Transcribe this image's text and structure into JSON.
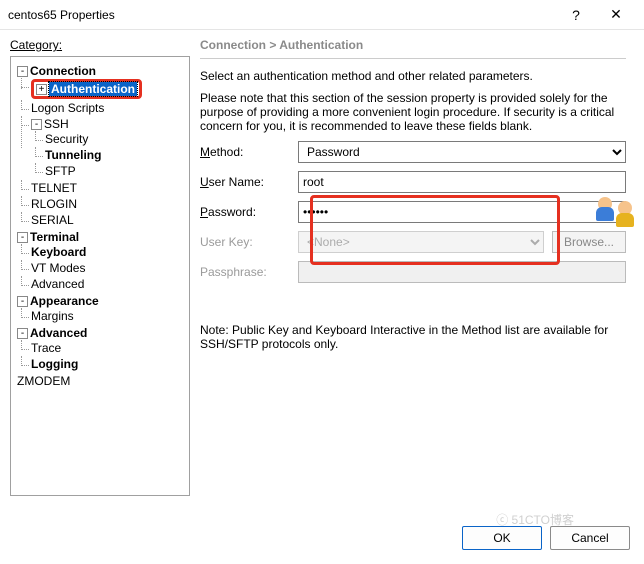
{
  "window": {
    "title": "centos65 Properties",
    "help": "?",
    "close": "✕"
  },
  "category_label": "Category:",
  "tree": {
    "connection": "Connection",
    "authentication": "Authentication",
    "logon_scripts": "Logon Scripts",
    "ssh": "SSH",
    "security": "Security",
    "tunneling": "Tunneling",
    "sftp": "SFTP",
    "telnet": "TELNET",
    "rlogin": "RLOGIN",
    "serial": "SERIAL",
    "terminal": "Terminal",
    "keyboard": "Keyboard",
    "vt_modes": "VT Modes",
    "advanced_t": "Advanced",
    "appearance": "Appearance",
    "margins": "Margins",
    "advanced": "Advanced",
    "trace": "Trace",
    "logging": "Logging",
    "zmodem": "ZMODEM"
  },
  "panel": {
    "breadcrumb": "Connection > Authentication",
    "desc1": "Select an authentication method and other related parameters.",
    "desc2": "Please note that this section of the session property is provided solely for the purpose of providing a more convenient login procedure. If security is a critical concern for you, it is recommended to leave these fields blank.",
    "method_label": "Method:",
    "method_value": "Password",
    "user_label": "User Name:",
    "user_value": "root",
    "password_label": "Password:",
    "password_value": "••••••",
    "userkey_label": "User Key:",
    "userkey_value": "<None>",
    "browse": "Browse...",
    "passphrase_label": "Passphrase:",
    "note": "Note: Public Key and Keyboard Interactive in the Method list are available for SSH/SFTP protocols only."
  },
  "footer": {
    "ok": "OK",
    "cancel": "Cancel"
  },
  "watermark": "ⓒ 51CTO博客"
}
